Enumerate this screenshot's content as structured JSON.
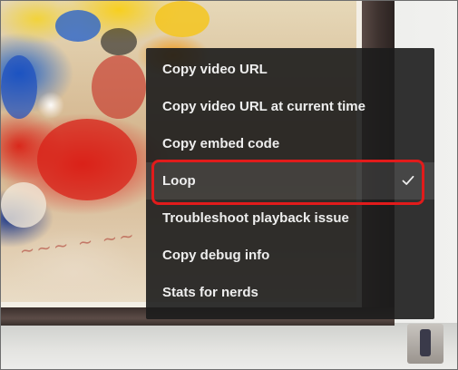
{
  "context_menu": {
    "items": [
      {
        "label": "Copy video URL",
        "checked": false
      },
      {
        "label": "Copy video URL at current time",
        "checked": false
      },
      {
        "label": "Copy embed code",
        "checked": false
      },
      {
        "label": "Loop",
        "checked": true
      },
      {
        "label": "Troubleshoot playback issue",
        "checked": false
      },
      {
        "label": "Copy debug info",
        "checked": false
      },
      {
        "label": "Stats for nerds",
        "checked": false
      }
    ]
  },
  "annotation": {
    "highlight_color": "#e11b1b",
    "highlighted_item": "Loop"
  },
  "colors": {
    "menu_background": "#1c1c1c",
    "menu_text": "#eeeeee"
  },
  "icons": {
    "check": "checkmark-icon"
  }
}
